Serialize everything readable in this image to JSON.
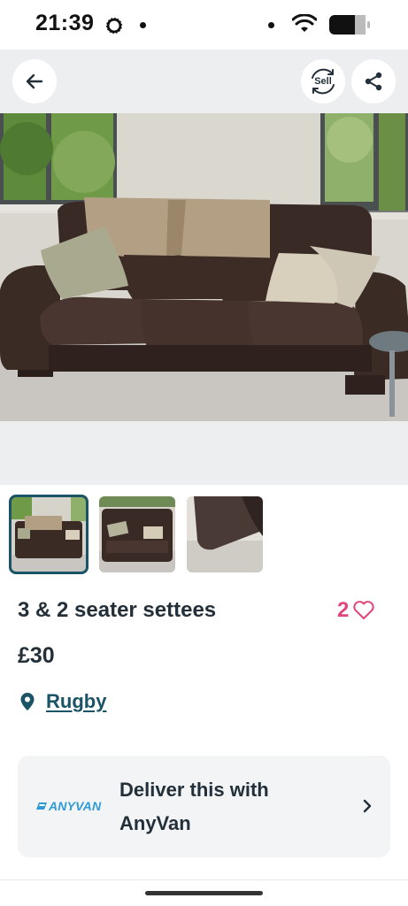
{
  "status_bar": {
    "time": "21:39",
    "icons": [
      "signal-messenger-icon",
      "dot-icon",
      "dot-icon",
      "wifi-icon",
      "battery-icon"
    ]
  },
  "top_bar": {
    "back_icon": "arrow-left-icon",
    "sell_label": "Sell",
    "share_icon": "share-icon"
  },
  "gallery": {
    "thumbnail_count": 3,
    "selected_index": 0
  },
  "listing": {
    "title": "3 & 2 seater settees",
    "likes": "2",
    "price": "£30",
    "location": "Rugby"
  },
  "delivery": {
    "partner_logo": "ANYVAN",
    "text": "Deliver this with AnyVan"
  },
  "colors": {
    "accent": "#1a5466",
    "like": "#e0467c",
    "anyvan": "#2f9bd6",
    "text": "#23303a"
  }
}
